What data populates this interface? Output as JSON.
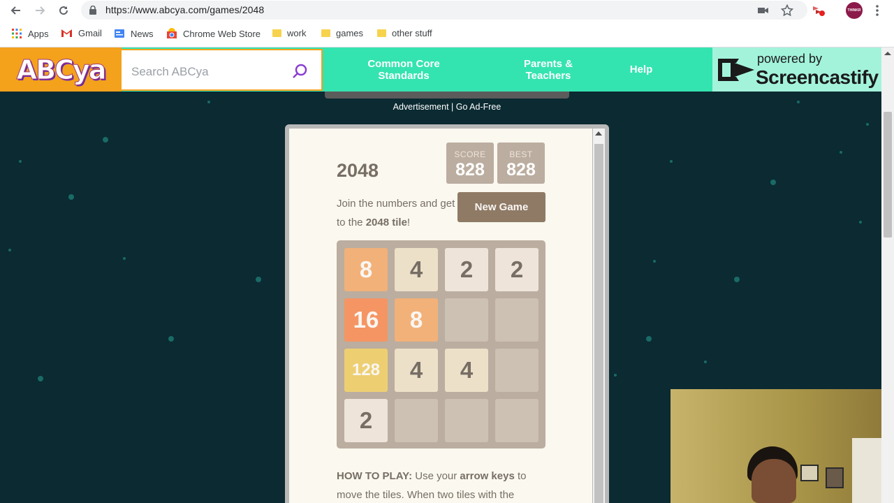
{
  "browser": {
    "url": "https://www.abcya.com/games/2048",
    "bookmarks": [
      {
        "label": "Apps",
        "icon": "apps-grid-icon"
      },
      {
        "label": "Gmail",
        "icon": "gmail-icon"
      },
      {
        "label": "News",
        "icon": "news-icon"
      },
      {
        "label": "Chrome Web Store",
        "icon": "chrome-web-store-icon"
      },
      {
        "label": "work",
        "icon": "folder-icon"
      },
      {
        "label": "games",
        "icon": "folder-icon"
      },
      {
        "label": "other stuff",
        "icon": "folder-icon"
      }
    ],
    "profile_initials": "THINKR"
  },
  "site": {
    "logo": "ABCya",
    "search_placeholder": "Search ABCya",
    "nav": {
      "common_core": "Common Core Standards",
      "parents_teachers": "Parents & Teachers",
      "help": "Help"
    }
  },
  "overlay": {
    "powered_by": "powered by",
    "brand": "Screencastify"
  },
  "ad_text": "Advertisement | Go Ad-Free",
  "game": {
    "title": "2048",
    "score_label": "SCORE",
    "score": "828",
    "best_label": "BEST",
    "best": "828",
    "intro_prefix": "Join the numbers and get to the ",
    "intro_bold": "2048 tile",
    "intro_suffix": "!",
    "new_game_label": "New Game",
    "board": [
      [
        8,
        4,
        2,
        2
      ],
      [
        16,
        8,
        null,
        null
      ],
      [
        128,
        4,
        4,
        null
      ],
      [
        2,
        null,
        null,
        null
      ]
    ],
    "tile_colors": {
      "2": {
        "bg": "#eee4da",
        "fg": "#776e65"
      },
      "4": {
        "bg": "#ede0c8",
        "fg": "#776e65"
      },
      "8": {
        "bg": "#f2b179",
        "fg": "#f9f6f2"
      },
      "16": {
        "bg": "#f59563",
        "fg": "#f9f6f2"
      },
      "128": {
        "bg": "#edcf72",
        "fg": "#f9f6f2"
      }
    },
    "howto_label": "HOW TO PLAY:",
    "howto_text1": " Use your ",
    "howto_bold": "arrow keys",
    "howto_text2": " to move the tiles. When two tiles with the"
  },
  "colors": {
    "page_bg": "#0b2a32",
    "header_green": "#34e4b0",
    "logo_orange": "#f4a11b",
    "game_bg": "#faf8ef",
    "board_bg": "#bbada0",
    "empty_cell": "#cdc1b4",
    "new_game_btn": "#8f7a66"
  }
}
